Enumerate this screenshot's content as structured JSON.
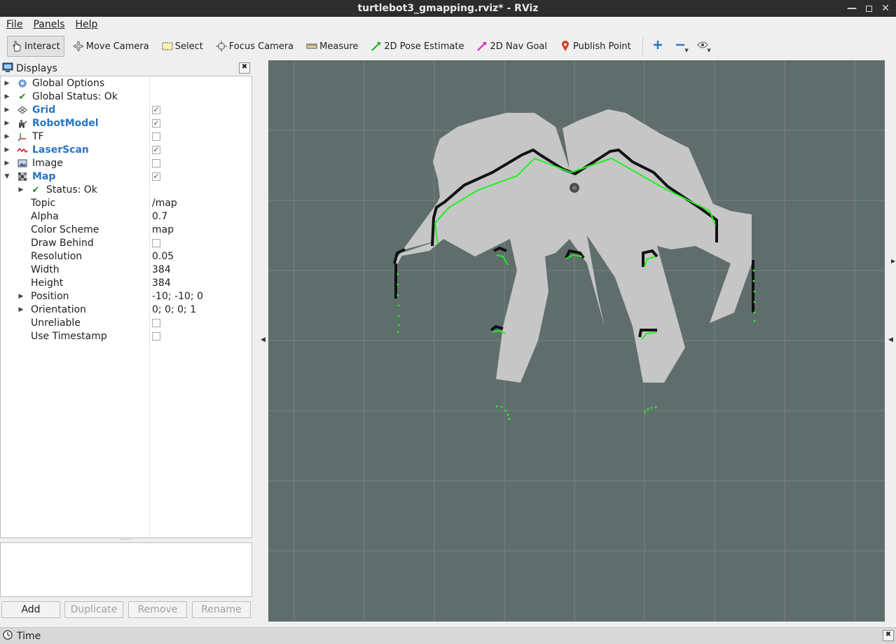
{
  "window": {
    "title": "turtlebot3_gmapping.rviz* - RViz",
    "minimize": "—",
    "maximize": "",
    "close": "✕"
  },
  "menu": {
    "file": "File",
    "panels": "Panels",
    "help": "Help"
  },
  "toolbar": {
    "interact": "Interact",
    "move_camera": "Move Camera",
    "select": "Select",
    "focus_camera": "Focus Camera",
    "measure": "Measure",
    "pose_estimate": "2D Pose Estimate",
    "nav_goal": "2D Nav Goal",
    "publish_point": "Publish Point"
  },
  "displays": {
    "title": "Displays",
    "close": "✖",
    "rows": [
      {
        "label": "Global Options"
      },
      {
        "label": "Global Status: Ok"
      },
      {
        "label": "Grid",
        "checked": "✓"
      },
      {
        "label": "RobotModel",
        "checked": "✓"
      },
      {
        "label": "TF",
        "checked": ""
      },
      {
        "label": "LaserScan",
        "checked": "✓"
      },
      {
        "label": "Image",
        "checked": ""
      },
      {
        "label": "Map",
        "checked": "✓"
      }
    ],
    "map_props": {
      "status": "Status: Ok",
      "topic_label": "Topic",
      "topic": "/map",
      "alpha_label": "Alpha",
      "alpha": "0.7",
      "color_scheme_label": "Color Scheme",
      "color_scheme": "map",
      "draw_behind_label": "Draw Behind",
      "draw_behind": "",
      "resolution_label": "Resolution",
      "resolution": "0.05",
      "width_label": "Width",
      "width": "384",
      "height_label": "Height",
      "height": "384",
      "position_label": "Position",
      "position": "-10; -10; 0",
      "orientation_label": "Orientation",
      "orientation": "0; 0; 0; 1",
      "unreliable_label": "Unreliable",
      "unreliable": "",
      "use_timestamp_label": "Use Timestamp",
      "use_timestamp": ""
    },
    "buttons": {
      "add": "Add",
      "duplicate": "Duplicate",
      "remove": "Remove",
      "rename": "Rename"
    }
  },
  "time_panel": {
    "title": "Time",
    "close": "✖"
  },
  "colors": {
    "viewport_bg": "#5f6e6c",
    "map_free": "#c6c6c6",
    "map_occupied": "#111111",
    "laser": "#22ee22",
    "blue_label": "#2a74c5"
  }
}
